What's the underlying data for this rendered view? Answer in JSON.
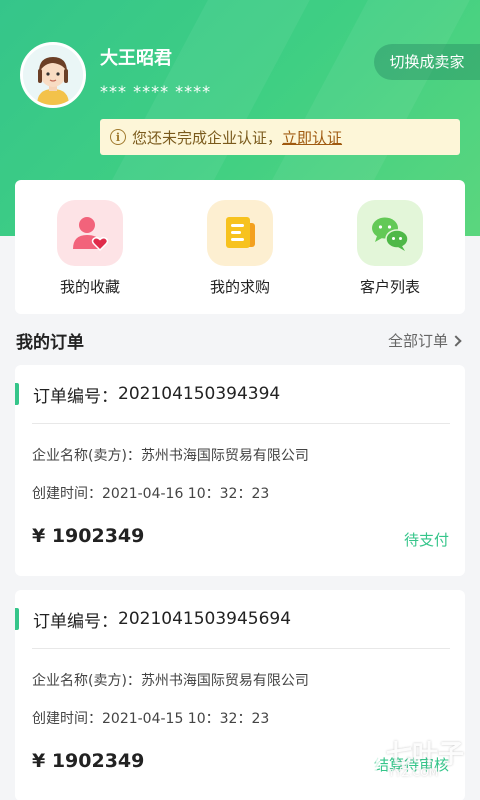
{
  "profile": {
    "name": "大王昭君",
    "phone_masked": "*** **** ****",
    "switch_label": "切换成卖家"
  },
  "notice": {
    "text": "您还未完成企业认证，",
    "link": "立即认证"
  },
  "quick_actions": [
    {
      "label": "我的收藏",
      "icon": "favorites-icon",
      "bg": "#fde3e6"
    },
    {
      "label": "我的求购",
      "icon": "purchase-icon",
      "bg": "#fdefd1"
    },
    {
      "label": "客户列表",
      "icon": "customers-chat-icon",
      "bg": "#e3f6d9"
    }
  ],
  "orders_section": {
    "title": "我的订单",
    "all_label": "全部订单"
  },
  "orders": [
    {
      "no_label": "订单编号：",
      "no": "202104150394394",
      "seller_label": "企业名称(卖方)：",
      "seller": "苏州书海国际贸易有限公司",
      "created_label": "创建时间：",
      "created": "2021-04-16 10：32：23",
      "price": "¥ 1902349",
      "status": "待支付"
    },
    {
      "no_label": "订单编号：",
      "no": "2021041503945694",
      "seller_label": "企业名称(卖方)：",
      "seller": "苏州书海国际贸易有限公司",
      "created_label": "创建时间：",
      "created": "2021-04-15 10：32：23",
      "price": "¥ 1902349",
      "status": "结算待审核"
    }
  ],
  "watermark": {
    "text": "七叶子",
    "sub": "YYZ.COM"
  },
  "colors": {
    "brand_green": "#35c58a",
    "notice_bg": "#fdf6d8"
  }
}
